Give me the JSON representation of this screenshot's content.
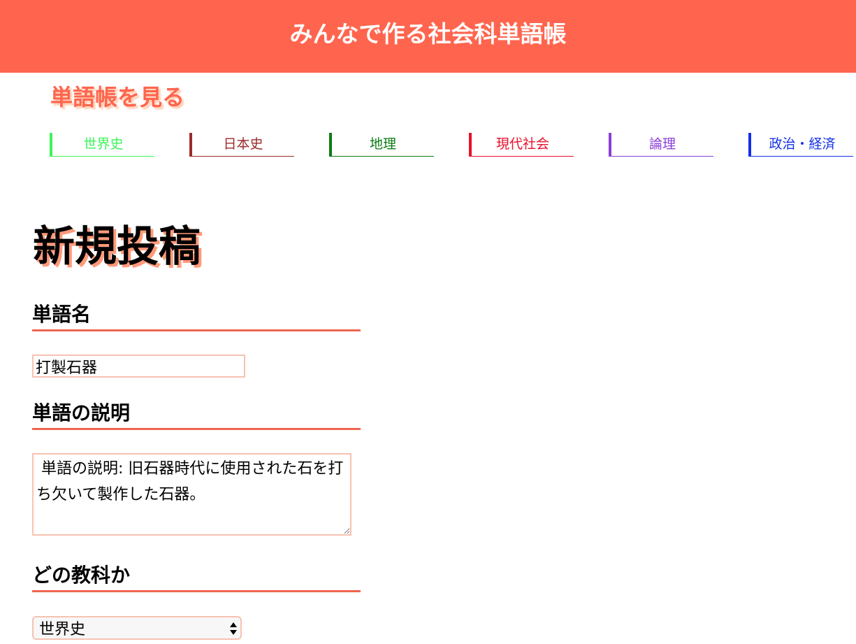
{
  "header": {
    "title": "みんなで作る社会科単語帳"
  },
  "nav": {
    "view_link": "単語帳を見る",
    "subjects": [
      {
        "label": "世界史",
        "color": "#3ff35a"
      },
      {
        "label": "日本史",
        "color": "#9c2a2a"
      },
      {
        "label": "地理",
        "color": "#0d7a12"
      },
      {
        "label": "現代社会",
        "color": "#e8102b"
      },
      {
        "label": "論理",
        "color": "#8a3fd6"
      },
      {
        "label": "政治・経済",
        "color": "#1330e8"
      }
    ]
  },
  "form": {
    "heading": "新規投稿",
    "word_label": "単語名",
    "word_value": "打製石器",
    "description_label": "単語の説明",
    "description_value": " 単語の説明: 旧石器時代に使用された石を打ち欠いて製作した石器。",
    "subject_label": "どの教科か",
    "subject_selected": "世界史"
  },
  "colors": {
    "accent": "#ff654e",
    "field_border": "#f8c2b0"
  }
}
